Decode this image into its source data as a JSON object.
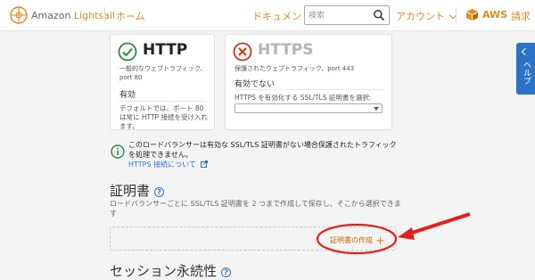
{
  "nav": {
    "brand_prefix": "Amazon ",
    "brand_name": "Lightsail",
    "home": "ホーム",
    "docs": "ドキュメント",
    "search_placeholder": "検索",
    "account": "アカウント",
    "aws": "AWS",
    "billing": "請求",
    "icons": [
      "lightsail-logo-icon",
      "search-icon",
      "chevron-down-icon",
      "aws-box-icon"
    ]
  },
  "help_tab": {
    "label": "ヘルプ"
  },
  "http_card": {
    "title": "HTTP",
    "desc": "一般的なウェブトラフィック、port 80",
    "status": "有効",
    "note": "デフォルトでは、ポート 80 は常に HTTP 接続を受け入れます。",
    "icon": "check-circle-icon"
  },
  "https_card": {
    "title": "HTTPS",
    "desc": "保護されたウェブトラフィック、port 443",
    "status": "有効でない",
    "select_label": "HTTPS を有効化する SSL/TLS 証明書を選択:",
    "selected": "",
    "icon": "x-circle-icon"
  },
  "info": {
    "text": "このロードバランサーは有効な SSL/TLS 証明書がない場合保護されたトラフィックを処理できません。",
    "link": "HTTPS 接続について"
  },
  "certificates": {
    "heading": "証明書",
    "desc": "ロードバランサーごとに SSL/TLS 証明書を 2 つまで作成して保存し、そこから選択できます",
    "create": "証明書の作成"
  },
  "session": {
    "heading": "セッション永続性"
  },
  "colors": {
    "accent": "#e8891c",
    "link": "#2c73c7",
    "annotation": "#e5201b",
    "success": "#2b8a3e"
  }
}
